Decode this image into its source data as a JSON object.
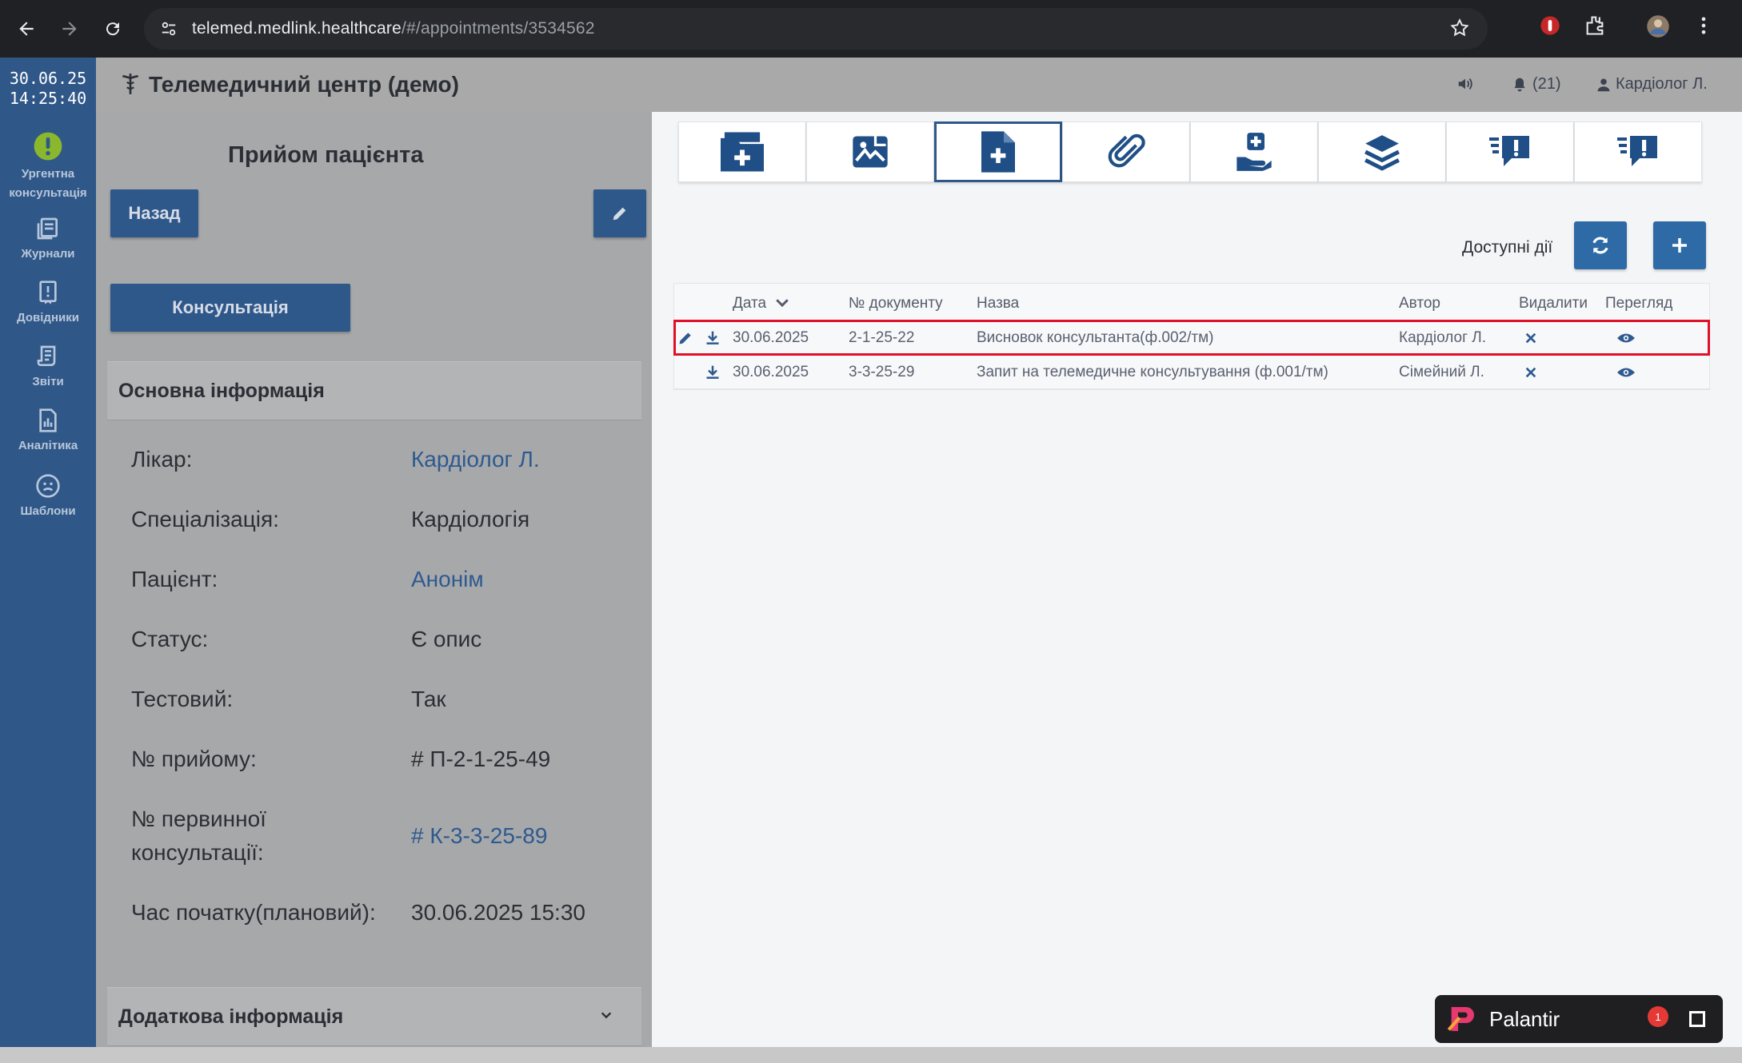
{
  "browser": {
    "url_host": "telemed.medlink.healthcare",
    "url_path": "/#/appointments/3534562"
  },
  "sidebar": {
    "date": "30.06.25",
    "time": "14:25:40",
    "items": [
      {
        "label": "Ургентна консультація"
      },
      {
        "label": "Журнали"
      },
      {
        "label": "Довідники"
      },
      {
        "label": "Звіти"
      },
      {
        "label": "Аналітика"
      },
      {
        "label": "Шаблони"
      }
    ]
  },
  "header": {
    "title": "Телемедичний центр (демо)",
    "notifications": "(21)",
    "user": "Кардіолог Л."
  },
  "left": {
    "back_label": "Назад",
    "heading": "Прийом пацієнта",
    "consult_label": "Консультація",
    "main_info_title": "Основна інформація",
    "extra_info_title": "Додаткова інформація",
    "fields": [
      {
        "label": "Лікар:",
        "value": "Кардіолог Л."
      },
      {
        "label": "Спеціалізація:",
        "value": "Кардіологія"
      },
      {
        "label": "Пацієнт:",
        "value": "Анонім"
      },
      {
        "label": "Статус:",
        "value": "Є опис"
      },
      {
        "label": "Тестовий:",
        "value": "Так"
      },
      {
        "label": "№ прийому:",
        "value": "# П-2-1-25-49"
      },
      {
        "label": "№ первинної консультації:",
        "value": "# К-3-3-25-89"
      },
      {
        "label": "Час початку(плановий):",
        "value": "30.06.2025 15:30"
      }
    ]
  },
  "right": {
    "actions_label": "Доступні дії",
    "table": {
      "headers": {
        "date": "Дата",
        "number": "№ документу",
        "name": "Назва",
        "author": "Автор",
        "delete": "Видалити",
        "view": "Перегляд"
      },
      "rows": [
        {
          "date": "30.06.2025",
          "number": "2-1-25-22",
          "name": "Висновок консультанта(ф.002/тм)",
          "author": "Кардіолог Л."
        },
        {
          "date": "30.06.2025",
          "number": "3-3-25-29",
          "name": "Запит на телемедичне консультування (ф.001/тм)",
          "author": "Сімейний Л."
        }
      ]
    }
  },
  "palantir": {
    "name": "Palantir",
    "badge": "1"
  }
}
